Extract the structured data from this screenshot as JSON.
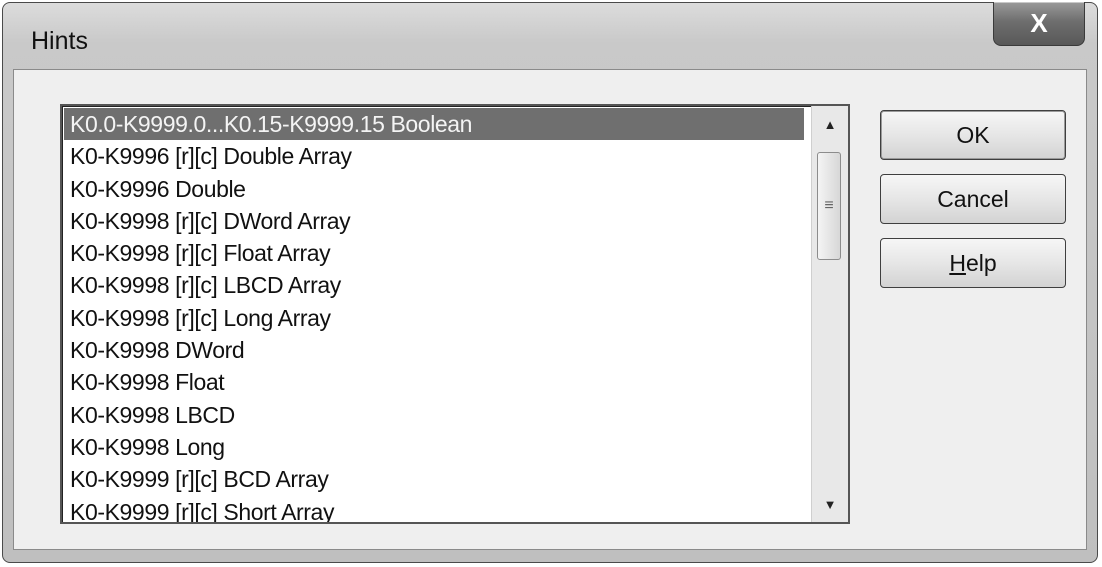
{
  "window": {
    "title": "Hints",
    "close_glyph": "X"
  },
  "list": {
    "items": [
      "K0.0-K9999.0...K0.15-K9999.15 Boolean",
      "K0-K9996 [r][c] Double Array",
      "K0-K9996 Double",
      "K0-K9998 [r][c] DWord Array",
      "K0-K9998 [r][c] Float Array",
      "K0-K9998 [r][c] LBCD Array",
      "K0-K9998 [r][c] Long Array",
      "K0-K9998 DWord",
      "K0-K9998 Float",
      "K0-K9998 LBCD",
      "K0-K9998 Long",
      "K0-K9999 [r][c] BCD Array",
      "K0-K9999 [r][c] Short Array"
    ],
    "selected_index": 0
  },
  "buttons": {
    "ok": "OK",
    "cancel": "Cancel",
    "help_label": "Help",
    "help_mnemonic": "H",
    "help_rest": "elp"
  },
  "icons": {
    "scroll_up": "up-arrow-icon",
    "scroll_down": "down-arrow-icon",
    "grip": "thumb-grip-icon"
  }
}
